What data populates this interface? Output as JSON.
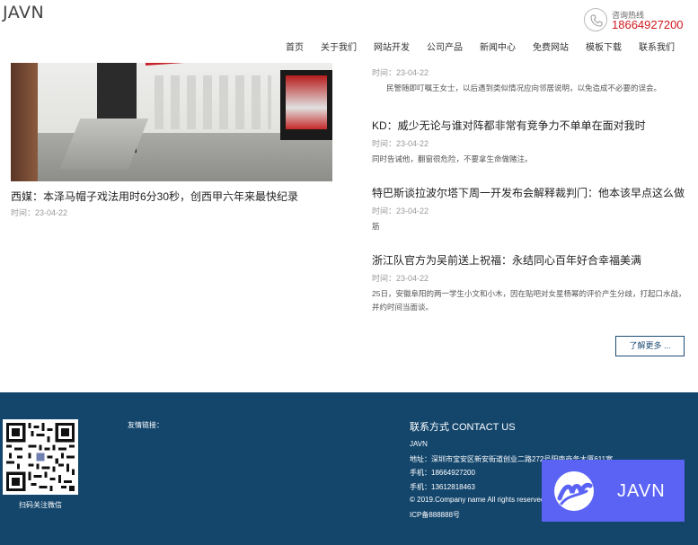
{
  "header": {
    "logo": "JAVN",
    "hotline_label": "咨询热线",
    "hotline_number": "18664927200"
  },
  "nav": [
    "首页",
    "关于我们",
    "网站开发",
    "公司产品",
    "新闻中心",
    "免费网站",
    "模板下载",
    "联系我们"
  ],
  "featured": {
    "title": "西媒：本泽马帽子戏法用时6分30秒，创西甲六年来最快纪录",
    "time": "时间：23-04-22"
  },
  "news": [
    {
      "title": "",
      "time": "时间：23-04-22",
      "excerpt": "民警随即叮嘱王女士，以后遇到类似情况应向邻居说明，以免造成不必要的误会。"
    },
    {
      "title": "KD：威少无论与谁对阵都非常有竞争力不单单在面对我时",
      "time": "时间：23-04-22",
      "excerpt": "同时告诫他，翻窗很危险，不要拿生命做赌注。"
    },
    {
      "title": "特巴斯谈拉波尔塔下周一开发布会解释裁判门：他本该早点这么做",
      "time": "时间：23-04-22",
      "excerpt": "筋"
    },
    {
      "title": "浙江队官方为吴前送上祝福：永结同心百年好合幸福美满",
      "time": "时间：23-04-22",
      "excerpt": "25日，安徽阜阳的两一学生小文和小木，因在贴吧对女星杨幂的评价产生分歧，打起口水战，并约时间当面谈。"
    }
  ],
  "more_label": "了解更多 ...",
  "footer": {
    "qr_label": "扫码关注微信",
    "links_label": "友情链接：",
    "contact_heading": "联系方式 CONTACT US",
    "contact_lines": [
      "JAVN",
      "地址：深圳市宝安区新安街道创业二路272号阳南商务大厦611室",
      "手机：18664927200",
      "手机：13612818463",
      "© 2019.Company name All rights reserved",
      "ICP备888888号"
    ]
  },
  "badge": {
    "text": "JAVN"
  },
  "colors": {
    "accent_red": "#d0191f",
    "footer_bg": "#14466c",
    "badge_bg": "#5b63f5"
  }
}
